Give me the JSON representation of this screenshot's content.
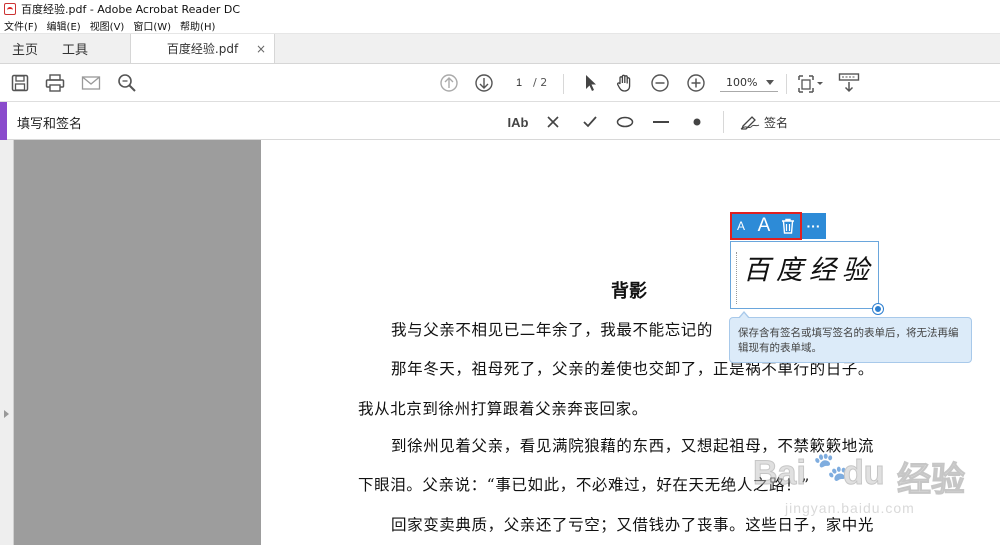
{
  "window": {
    "title": "百度经验.pdf - Adobe Acrobat Reader DC"
  },
  "menu": [
    "文件(F)",
    "编辑(E)",
    "视图(V)",
    "窗口(W)",
    "帮助(H)"
  ],
  "tabs": {
    "home": "主页",
    "tools": "工具",
    "document": "百度经验.pdf",
    "close": "×"
  },
  "toolbar": {
    "page_current": "1",
    "page_total": "/ 2",
    "zoom": "100%"
  },
  "fill_sign": {
    "title": "填写和签名",
    "text_tool": "IAb",
    "sign_label": "签名"
  },
  "signature": {
    "toolbar": {
      "small_a": "A",
      "large_a": "A",
      "more": "···"
    },
    "text": "百度经验",
    "tooltip": "保存含有签名或填写签名的表单后，将无法再编辑现有的表单域。"
  },
  "document": {
    "title": "背影",
    "lines": [
      "我与父亲不相见已二年余了，我最不能忘记的",
      "那年冬天，祖母死了，父亲的差使也交卸了，正是祸不单行的日子。",
      "我从北京到徐州打算跟着父亲奔丧回家。",
      "到徐州见着父亲，看见满院狼藉的东西，又想起祖母，不禁簌簌地流",
      "下眼泪。父亲说：“事已如此，不必难过，好在天无绝人之路！”",
      "回家变卖典质，父亲还了亏空；又借钱办了丧事。这些日子，家中光"
    ]
  },
  "watermark": {
    "brand": "Bai",
    "brand2": "du",
    "paw": "🐾",
    "text": "经验",
    "url": "jingyan.baidu.com"
  },
  "colors": {
    "accent_purple": "#8a4bcc",
    "annotation_blue": "#2d8bd7",
    "highlight_red": "#e02020",
    "gray_area": "#9d9d9d"
  }
}
